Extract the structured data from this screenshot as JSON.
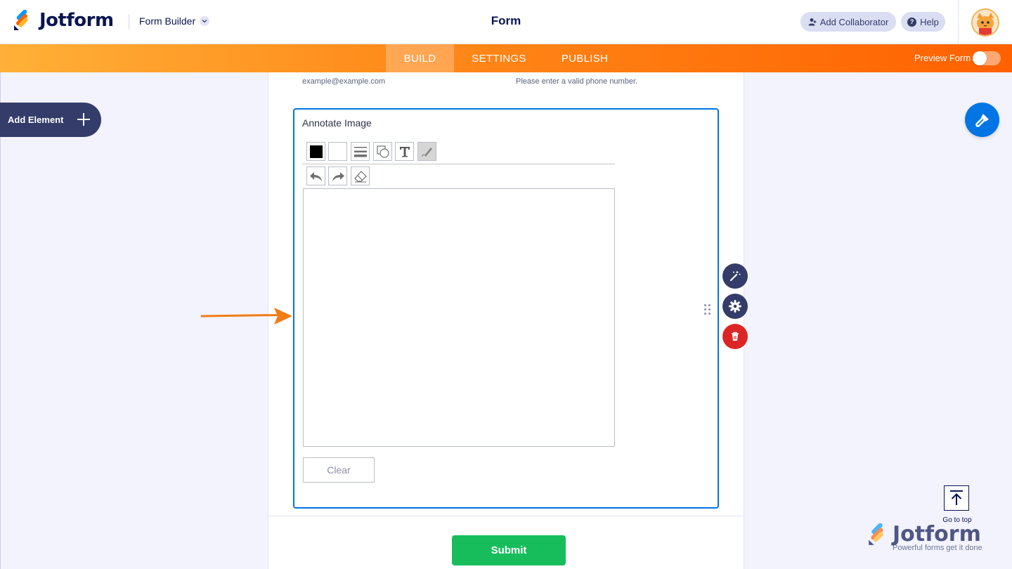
{
  "header": {
    "logo_text": "Jotform",
    "form_builder_label": "Form Builder",
    "page_title": "Form",
    "add_collaborator_label": "Add Collaborator",
    "help_label": "Help"
  },
  "nav": {
    "tabs": [
      {
        "label": "BUILD",
        "active": true
      },
      {
        "label": "SETTINGS",
        "active": false
      },
      {
        "label": "PUBLISH",
        "active": false
      }
    ],
    "preview_label": "Preview Form",
    "preview_enabled": false
  },
  "sidebar": {
    "add_element_label": "Add Element"
  },
  "form": {
    "email_sublabel": "example@example.com",
    "phone_sublabel": "Please enter a valid phone number.",
    "annotate": {
      "label": "Annotate Image",
      "tools_row1": [
        "color-black",
        "color-white",
        "line-width",
        "shapes",
        "text",
        "pen"
      ],
      "tools_row2": [
        "undo",
        "redo",
        "eraser"
      ],
      "selected_tool": "pen",
      "clear_label": "Clear"
    },
    "submit_label": "Submit"
  },
  "go_to_top_label": "Go to top",
  "watermark": {
    "brand": "Jotform",
    "tagline": "Powerful forms get it done"
  },
  "colors": {
    "accent_blue": "#0075e3",
    "nav_orange": "#ff6100",
    "submit_green": "#18bd5b",
    "delete_red": "#dc2626",
    "dark_navy": "#343c6a",
    "arrow_orange": "#f07d16"
  }
}
